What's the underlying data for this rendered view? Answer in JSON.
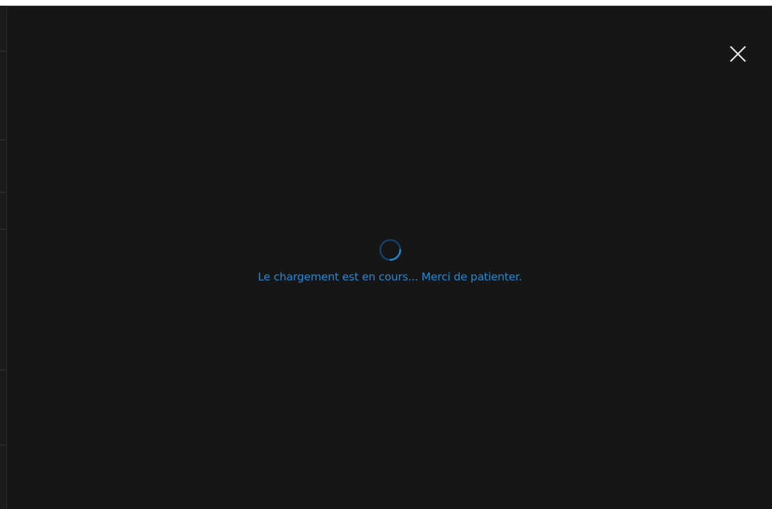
{
  "dialog": {
    "close_icon": "close-icon",
    "loading": {
      "spinner_icon": "spinner-icon",
      "message": "Le chargement est en cours... Merci de patienter."
    }
  },
  "colors": {
    "dialog_background": "#161616",
    "accent": "#1f8ad8",
    "close_icon": "#e6e6e6"
  }
}
